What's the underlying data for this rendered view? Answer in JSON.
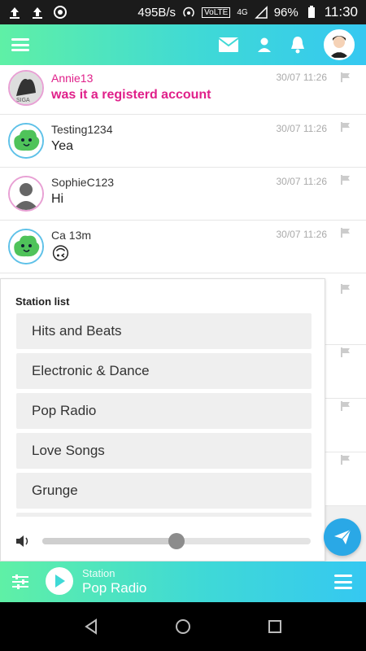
{
  "status_bar": {
    "speed": "495B/s",
    "network": "VoLTE",
    "signal": "4G",
    "battery": "96%",
    "time": "11:30",
    "icons": [
      "upload-icon",
      "upload-icon",
      "app-icon",
      "hotspot-icon",
      "signal-icon",
      "battery-icon"
    ]
  },
  "top_bar": {
    "icons": [
      "menu-icon",
      "mail-icon",
      "user-icon",
      "bell-icon",
      "profile-avatar"
    ],
    "accent_start": "#5ff0a6",
    "accent_end": "#35c8f1"
  },
  "messages": [
    {
      "name": "Annie13",
      "text": "was it a registerd account",
      "time": "30/07 11:26"
    },
    {
      "name": "Testing1234",
      "text": "Yea",
      "time": "30/07 11:26"
    },
    {
      "name": "SophieC123",
      "text": "Hi",
      "time": "30/07 11:26"
    },
    {
      "name": "Ca 13m",
      "text": "🙃",
      "time": "30/07 11:26"
    }
  ],
  "station_panel": {
    "title": "Station list",
    "stations": [
      "Hits and Beats",
      "Electronic & Dance",
      "Pop Radio",
      "Love Songs",
      "Grunge"
    ],
    "volume_level": 0.5
  },
  "player": {
    "label": "Station",
    "current_station": "Pop Radio"
  },
  "colors": {
    "highlight_pink": "#e0208a",
    "send_blue": "#2aa8e6"
  }
}
